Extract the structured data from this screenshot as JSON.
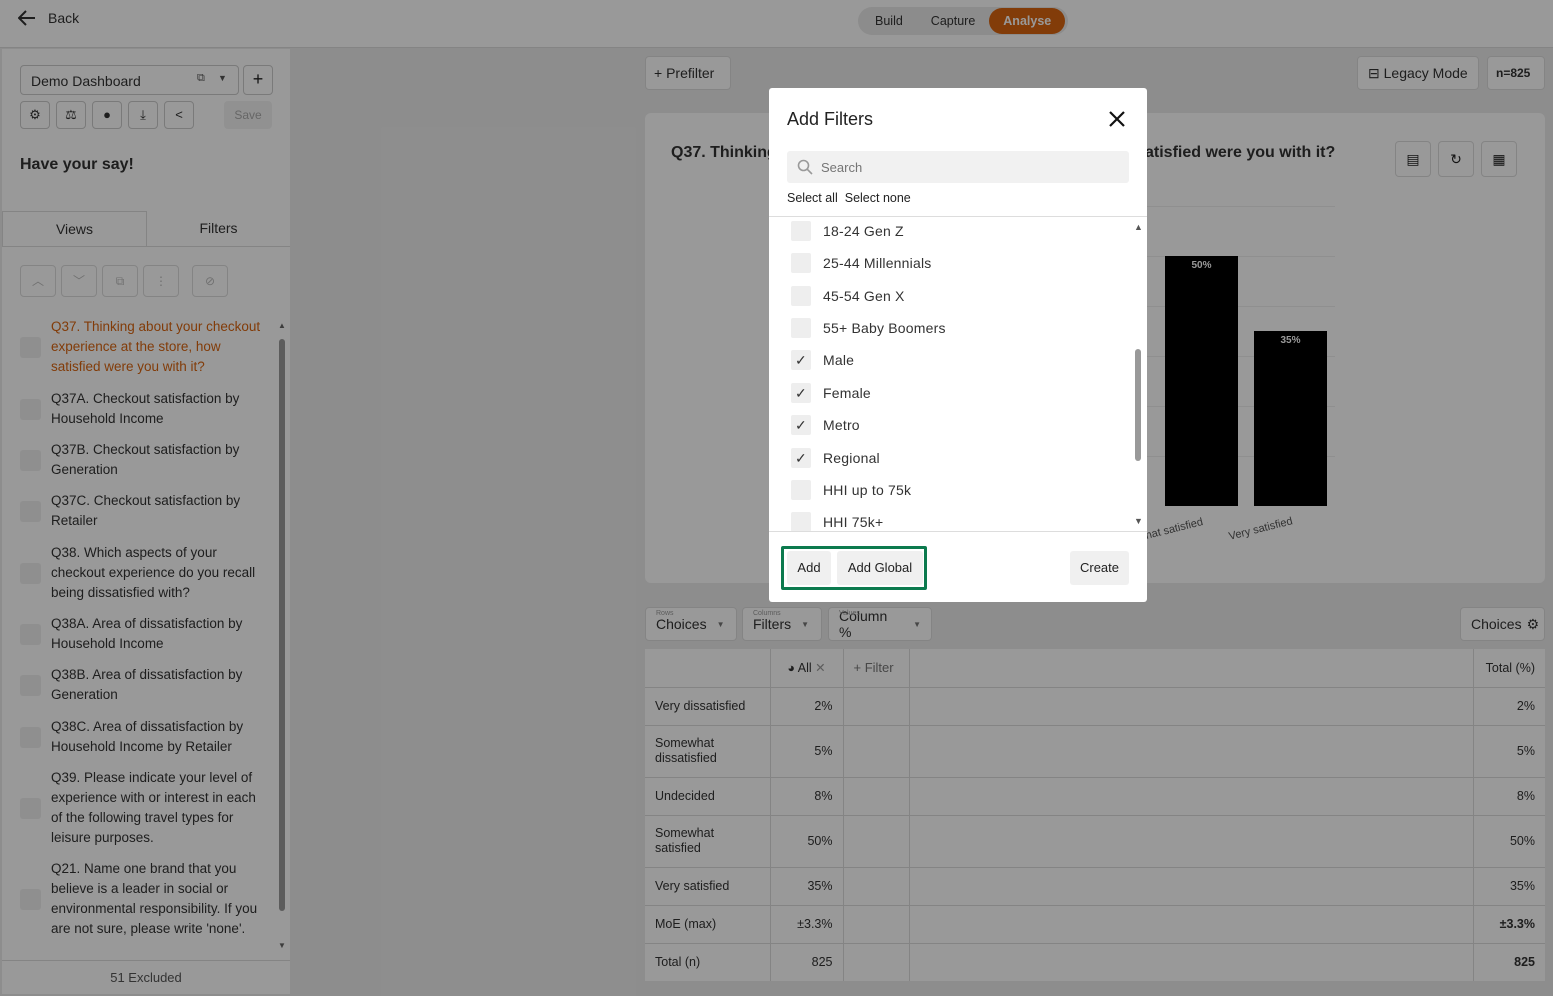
{
  "topbar": {
    "back_label": "Back",
    "tabs": [
      "Build",
      "Capture",
      "Analyse"
    ],
    "active_tab": "Analyse"
  },
  "sidebar": {
    "dashboard_name": "Demo Dashboard",
    "save_label": "Save",
    "heading": "Have your say!",
    "tabs": [
      "Views",
      "Filters"
    ],
    "questions": [
      "Q37. Thinking about your checkout experience at the store, how satisfied were you with it?",
      "Q37A. Checkout satisfaction by Household Income",
      "Q37B. Checkout satisfaction by Generation",
      "Q37C. Checkout satisfaction by Retailer",
      "Q38. Which aspects of your checkout experience do you recall being dissatisfied with?",
      "Q38A. Area of dissatisfaction by Household Income",
      "Q38B. Area of dissatisfaction by Generation",
      "Q38C. Area of dissatisfaction by Household Income by Retailer",
      "Q39. Please indicate your level of experience with or interest in each of the following travel types for leisure purposes.",
      "Q21. Name one brand that you believe is a leader in social or environmental responsibility. If you are not sure, please write 'none'."
    ],
    "excluded": "51 Excluded"
  },
  "main": {
    "prefilter_label": "Prefilter",
    "legacy_label": "Legacy Mode",
    "n_label": "n=825",
    "card_title_left": "Q37. Thinking",
    "card_title_right": "atisfied were you with it?",
    "bar_labels": [
      "50%",
      "35%"
    ],
    "x_labels": [
      "hat satisfied",
      "Very satisfied"
    ],
    "dropdowns": [
      {
        "small": "Rows",
        "label": "Choices"
      },
      {
        "small": "Columns",
        "label": "Filters"
      },
      {
        "small": "Values",
        "label": "Column %"
      }
    ],
    "choices_label": "Choices",
    "table": {
      "col_all": "All",
      "col_filter": "Filter",
      "col_total": "Total (%)",
      "rows": [
        {
          "label": "Very dissatisfied",
          "all": "2%",
          "total": "2%"
        },
        {
          "label": "Somewhat dissatisfied",
          "all": "5%",
          "total": "5%"
        },
        {
          "label": "Undecided",
          "all": "8%",
          "total": "8%"
        },
        {
          "label": "Somewhat satisfied",
          "all": "50%",
          "total": "50%"
        },
        {
          "label": "Very satisfied",
          "all": "35%",
          "total": "35%"
        },
        {
          "label": "MoE (max)",
          "all": "±3.3%",
          "total": "±3.3%"
        },
        {
          "label": "Total (n)",
          "all": "825",
          "total": "825"
        }
      ]
    }
  },
  "chart_data": {
    "type": "bar",
    "categories": [
      "Somewhat satisfied",
      "Very satisfied"
    ],
    "values": [
      50,
      35
    ],
    "ylim": [
      0,
      50
    ]
  },
  "modal": {
    "title": "Add Filters",
    "search_placeholder": "Search",
    "select_all": "Select all",
    "select_none": "Select none",
    "options": [
      {
        "label": "18-24 Gen Z",
        "checked": false
      },
      {
        "label": "25-44 Millennials",
        "checked": false
      },
      {
        "label": "45-54 Gen X",
        "checked": false
      },
      {
        "label": "55+ Baby Boomers",
        "checked": false
      },
      {
        "label": "Male",
        "checked": true
      },
      {
        "label": "Female",
        "checked": true
      },
      {
        "label": "Metro",
        "checked": true
      },
      {
        "label": "Regional",
        "checked": true
      },
      {
        "label": "HHI up to 75k",
        "checked": false
      },
      {
        "label": "HHI 75k+",
        "checked": false
      }
    ],
    "add_label": "Add",
    "add_global_label": "Add Global",
    "create_label": "Create"
  },
  "colors": {
    "accent": "#d9640f",
    "highlight": "#0c7a4e"
  }
}
